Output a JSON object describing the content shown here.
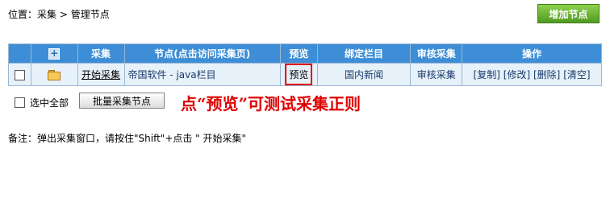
{
  "breadcrumb": {
    "prefix": "位置：",
    "item1": "采集",
    "separator": " > ",
    "item2": "管理节点"
  },
  "toolbar": {
    "add_node_label": "增加节点"
  },
  "table": {
    "headers": {
      "expand": "+",
      "collect": "采集",
      "node": "节点(点击访问采集页)",
      "preview": "预览",
      "bind_column": "绑定栏目",
      "review": "审核采集",
      "actions": "操作"
    },
    "rows": [
      {
        "collect_link": "开始采集",
        "node_name": "帝国软件 - java栏目",
        "preview": "预览",
        "bind_column": "国内新闻",
        "review": "审核采集",
        "actions": [
          "[复制]",
          "[修改]",
          "[删除]",
          "[清空]"
        ]
      }
    ]
  },
  "footer": {
    "select_all_label": "选中全部",
    "batch_button_label": "批量采集节点"
  },
  "annotation": "点“预览”可测试采集正则",
  "note": "备注：弹出采集窗口，请按住\"Shift\"+点击 \" 开始采集\"",
  "colors": {
    "header_bg": "#3d8ed6",
    "row_bg": "#e7f1fa",
    "add_button": "#6cb536",
    "annotation": "#e00000"
  }
}
